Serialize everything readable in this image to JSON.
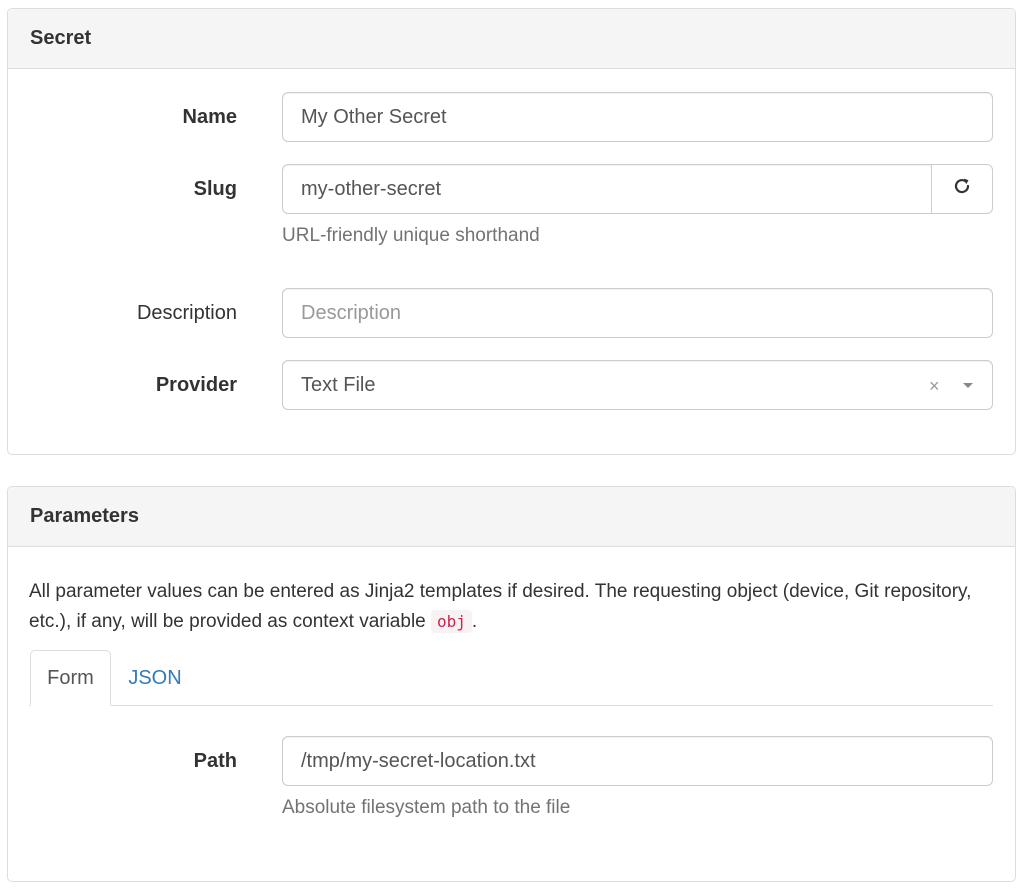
{
  "secret_panel": {
    "title": "Secret",
    "name": {
      "label": "Name",
      "value": "My Other Secret"
    },
    "slug": {
      "label": "Slug",
      "value": "my-other-secret",
      "help": "URL-friendly unique shorthand",
      "refresh_icon": "refresh-icon"
    },
    "description": {
      "label": "Description",
      "placeholder": "Description",
      "value": ""
    },
    "provider": {
      "label": "Provider",
      "value": "Text File",
      "clear_glyph": "×"
    }
  },
  "params_panel": {
    "title": "Parameters",
    "intro_before": "All parameter values can be entered as Jinja2 templates if desired. The requesting object (device, Git repository, etc.), if any, will be provided as context variable ",
    "intro_code": "obj",
    "intro_after": ".",
    "tabs": [
      {
        "label": "Form",
        "active": true
      },
      {
        "label": "JSON",
        "active": false
      }
    ],
    "path": {
      "label": "Path",
      "value": "/tmp/my-secret-location.txt",
      "help": "Absolute filesystem path to the file"
    }
  },
  "colors": {
    "link": "#337ab7",
    "code_text": "#c7254e",
    "code_bg": "#f9f2f4",
    "heading_bg": "#f5f5f5"
  }
}
